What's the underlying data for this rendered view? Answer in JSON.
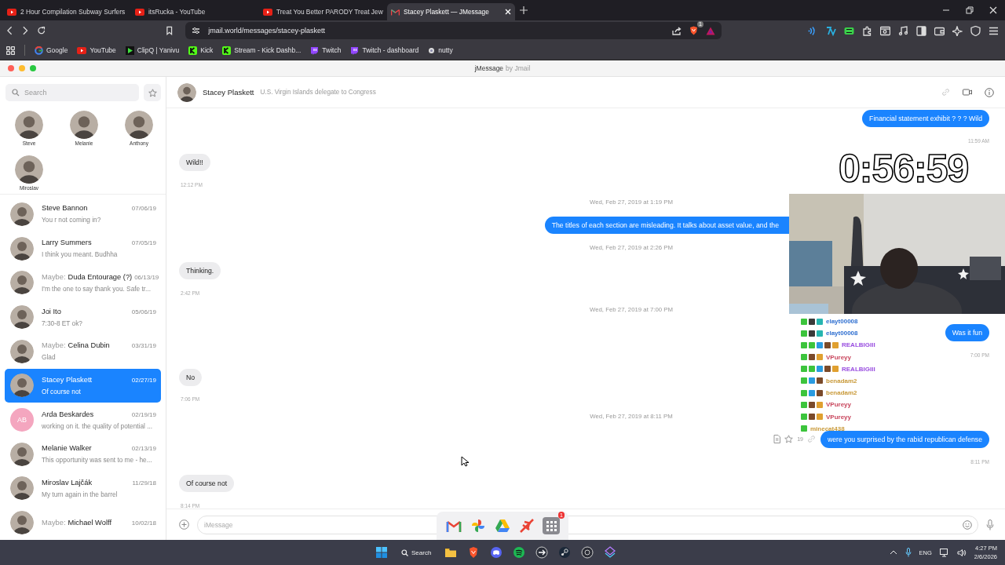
{
  "browser": {
    "tabs": [
      {
        "title": "2 Hour Compilation Subway Surfers",
        "selected": false
      },
      {
        "title": "itsRucka - YouTube",
        "selected": false
      },
      {
        "title": "Treat You Better PARODY Treat Jew",
        "selected": false
      },
      {
        "title": "Stacey Plaskett — JMessage",
        "selected": true
      }
    ],
    "url": "jmail.world/messages/stacey-plaskett",
    "extension_badge": "1",
    "bookmarks": [
      {
        "label": "Google"
      },
      {
        "label": "YouTube"
      },
      {
        "label": "ClipQ | Yanivu"
      },
      {
        "label": "Kick"
      },
      {
        "label": "Stream - Kick Dashb..."
      },
      {
        "label": "Twitch"
      },
      {
        "label": "Twitch - dashboard"
      },
      {
        "label": "nutty"
      }
    ]
  },
  "app": {
    "title": "jMessage",
    "subtitle": "by Jmail"
  },
  "sidebar": {
    "search": {
      "placeholder": "Search"
    },
    "pinned": [
      {
        "name": "Steve"
      },
      {
        "name": "Melanie"
      },
      {
        "name": "Anthony"
      },
      {
        "name": "Miroslav"
      }
    ],
    "conversations": [
      {
        "name": "Steve Bannon",
        "date": "07/06/19",
        "preview": "You r not coming in?",
        "selected": false
      },
      {
        "name": "Larry Summers",
        "date": "07/05/19",
        "preview": "I think you meant. Budhha",
        "selected": false
      },
      {
        "prefix": "Maybe:",
        "name": "Duda Entourage (?)",
        "date": "06/13/19",
        "preview": "I'm the one to say thank you. Safe tr...",
        "selected": false
      },
      {
        "name": "Joi Ito",
        "date": "05/06/19",
        "preview": "7:30-8 ET ok?",
        "selected": false
      },
      {
        "prefix": "Maybe:",
        "name": "Celina Dubin",
        "date": "03/31/19",
        "preview": "Glad",
        "selected": false
      },
      {
        "name": "Stacey Plaskett",
        "date": "02/27/19",
        "preview": "Of course not",
        "selected": true
      },
      {
        "name": "Arda Beskardes",
        "initials": "AB",
        "date": "02/19/19",
        "preview": "working on it. the quality of potential ...",
        "selected": false
      },
      {
        "name": "Melanie Walker",
        "date": "02/13/19",
        "preview": "This opportunity was sent to me - he...",
        "selected": false
      },
      {
        "name": "Miroslav Lajčák",
        "date": "11/29/18",
        "preview": "My turn again in the barrel",
        "selected": false
      },
      {
        "prefix": "Maybe:",
        "name": "Michael Wolff",
        "date": "10/02/18",
        "selected": false
      }
    ]
  },
  "chat": {
    "contact": {
      "name": "Stacey Plaskett",
      "description": "U.S. Virgin Islands delegate to Congress"
    },
    "messages": [
      {
        "kind": "sent",
        "text": "Financial statement exhibit ? ? ? Wild"
      },
      {
        "kind": "sent_time",
        "text": "11:59 AM"
      },
      {
        "kind": "received",
        "text": "Wild!!"
      },
      {
        "kind": "received_time",
        "text": "12:12 PM"
      },
      {
        "kind": "date",
        "text": "Wed, Feb 27, 2019 at 1:19 PM"
      },
      {
        "kind": "sent",
        "text": "The titles of each section are misleading. It talks about asset value, and the",
        "truncated": true
      },
      {
        "kind": "date",
        "text": "Wed, Feb 27, 2019 at 2:26 PM"
      },
      {
        "kind": "received",
        "text": "Thinking."
      },
      {
        "kind": "received_time",
        "text": "2:42 PM"
      },
      {
        "kind": "date",
        "text": "Wed, Feb 27, 2019 at 7:00 PM"
      },
      {
        "kind": "sent",
        "text": "Was it fun"
      },
      {
        "kind": "sent_time",
        "text": "7:00 PM"
      },
      {
        "kind": "received",
        "text": "No"
      },
      {
        "kind": "received_time",
        "text": "7:06 PM"
      },
      {
        "kind": "date",
        "text": "Wed, Feb 27, 2019 at 8:11 PM"
      },
      {
        "kind": "sent",
        "text": "were you surprised by the rabid republican defense",
        "star_count": "19"
      },
      {
        "kind": "sent_time",
        "text": "8:11 PM"
      },
      {
        "kind": "received",
        "text": "Of course not"
      },
      {
        "kind": "received_time",
        "text": "8:14 PM"
      }
    ],
    "input": {
      "placeholder": "iMessage"
    }
  },
  "stream_overlay": {
    "timer": "0:56:59",
    "chat": [
      {
        "user": "elayt00008",
        "color": "#2f6fd0"
      },
      {
        "user": "elayt00008",
        "color": "#2f6fd0"
      },
      {
        "user": "REALBIGIII",
        "color": "#9a4fe0"
      },
      {
        "user": "VPureyy",
        "color": "#c8455c"
      },
      {
        "user": "REALBIGIII",
        "color": "#9a4fe0"
      },
      {
        "user": "benadam2",
        "color": "#c99a3a"
      },
      {
        "user": "benadam2",
        "color": "#c99a3a"
      },
      {
        "user": "VPureyy",
        "color": "#c8455c"
      },
      {
        "user": "VPureyy",
        "color": "#c8455c"
      },
      {
        "user": "minecat438",
        "color": "#c99a3a"
      }
    ]
  },
  "dock": {
    "badge": "1"
  },
  "taskbar": {
    "search": "Search",
    "language": "ENG",
    "time": "4:27 PM",
    "date": "2/6/2026"
  }
}
